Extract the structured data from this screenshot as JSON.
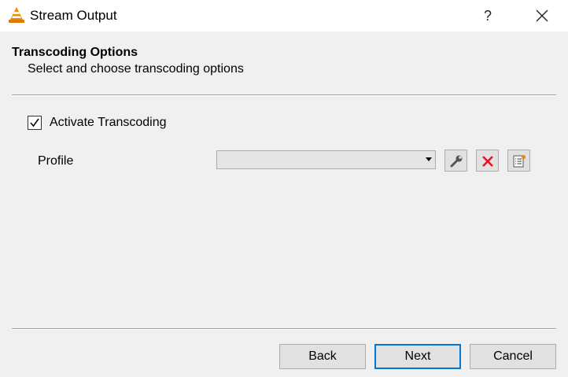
{
  "window": {
    "title": "Stream Output",
    "help_label": "?"
  },
  "page": {
    "title": "Transcoding Options",
    "subtitle": "Select and choose transcoding options"
  },
  "transcoding": {
    "activate_label": "Activate Transcoding",
    "activate_checked": true,
    "profile_label": "Profile",
    "profile_value": ""
  },
  "toolbar_icons": [
    "wrench-icon",
    "delete-x-icon",
    "new-profile-icon"
  ],
  "footer": {
    "back_label": "Back",
    "next_label": "Next",
    "cancel_label": "Cancel"
  },
  "colors": {
    "accent": "#0078d7",
    "delete": "#e81123",
    "vlc_orange": "#f08a00"
  }
}
